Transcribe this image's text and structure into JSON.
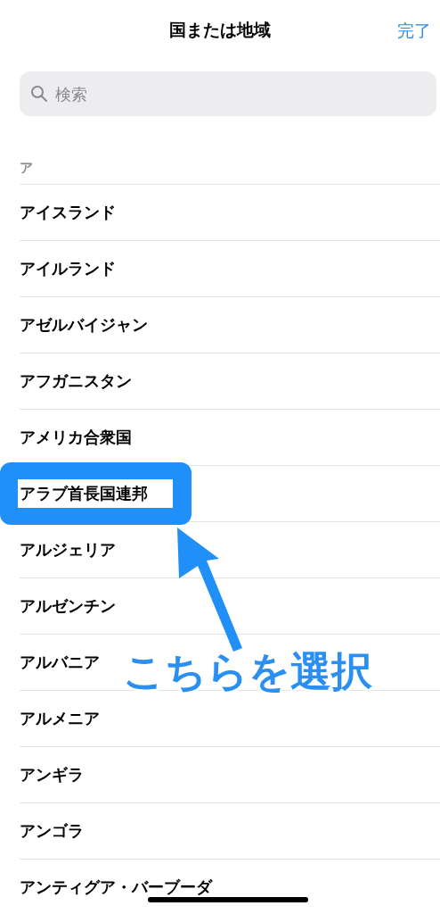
{
  "header": {
    "title": "国または地域",
    "done_button": "完了"
  },
  "search": {
    "placeholder": "検索"
  },
  "section": {
    "title": "ア"
  },
  "rows": [
    {
      "label": "アイスランド",
      "highlighted": false
    },
    {
      "label": "アイルランド",
      "highlighted": false
    },
    {
      "label": "アゼルバイジャン",
      "highlighted": false
    },
    {
      "label": "アフガニスタン",
      "highlighted": false
    },
    {
      "label": "アメリカ合衆国",
      "highlighted": false
    },
    {
      "label": "アラブ首長国連邦",
      "highlighted": true
    },
    {
      "label": "アルジェリア",
      "highlighted": false
    },
    {
      "label": "アルゼンチン",
      "highlighted": false
    },
    {
      "label": "アルバニア",
      "highlighted": false
    },
    {
      "label": "アルメニア",
      "highlighted": false
    },
    {
      "label": "アンギラ",
      "highlighted": false
    },
    {
      "label": "アンゴラ",
      "highlighted": false
    },
    {
      "label": "アンティグア・バーブーダ",
      "highlighted": false
    }
  ],
  "annotation": {
    "callout": "こちらを選択"
  }
}
